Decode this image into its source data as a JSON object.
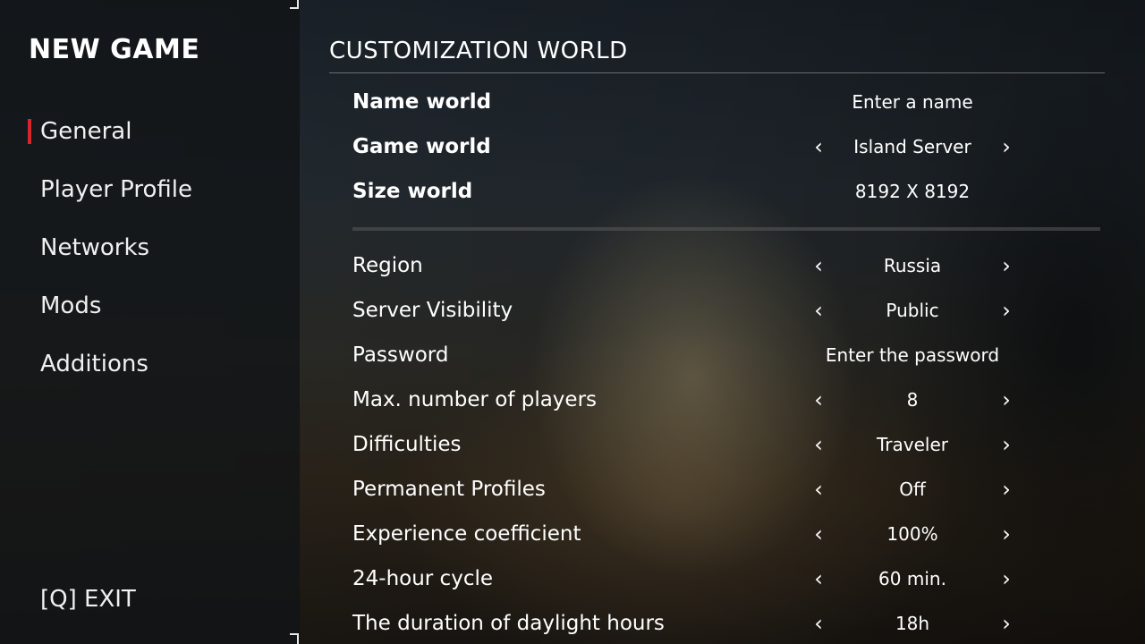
{
  "sidebar": {
    "title": "NEW GAME",
    "items": [
      {
        "label": "General",
        "active": true
      },
      {
        "label": "Player Profile",
        "active": false
      },
      {
        "label": "Networks",
        "active": false
      },
      {
        "label": "Mods",
        "active": false
      },
      {
        "label": "Additions",
        "active": false
      }
    ],
    "exit_label": "[Q] EXIT"
  },
  "main": {
    "section_title": "CUSTOMIZATION WORLD",
    "world_settings": {
      "name_world": {
        "label": "Name world",
        "placeholder": "Enter a name"
      },
      "game_world": {
        "label": "Game world",
        "value": "Island Server"
      },
      "size_world": {
        "label": "Size world",
        "value": "8192 X 8192"
      }
    },
    "server_settings": {
      "region": {
        "label": "Region",
        "value": "Russia"
      },
      "server_visibility": {
        "label": "Server Visibility",
        "value": "Public"
      },
      "password": {
        "label": "Password",
        "placeholder": "Enter the password"
      },
      "max_players": {
        "label": "Max. number of players",
        "value": "8"
      },
      "difficulties": {
        "label": "Difficulties",
        "value": "Traveler"
      },
      "permanent_profiles": {
        "label": "Permanent Profiles",
        "value": "Off"
      },
      "experience_coefficient": {
        "label": "Experience coefficient",
        "value": "100%"
      },
      "hour_cycle": {
        "label": "24-hour cycle",
        "value": "60 min."
      },
      "daylight_duration": {
        "label": "The duration of daylight hours",
        "value": "18h"
      }
    },
    "arrows": {
      "prev": "‹",
      "next": "›"
    }
  },
  "colors": {
    "accent": "#d6262b",
    "text": "#ffffff",
    "sidebar_bg": "#121416"
  },
  "icons": {
    "prev": "chevron-left-icon",
    "next": "chevron-right-icon"
  }
}
